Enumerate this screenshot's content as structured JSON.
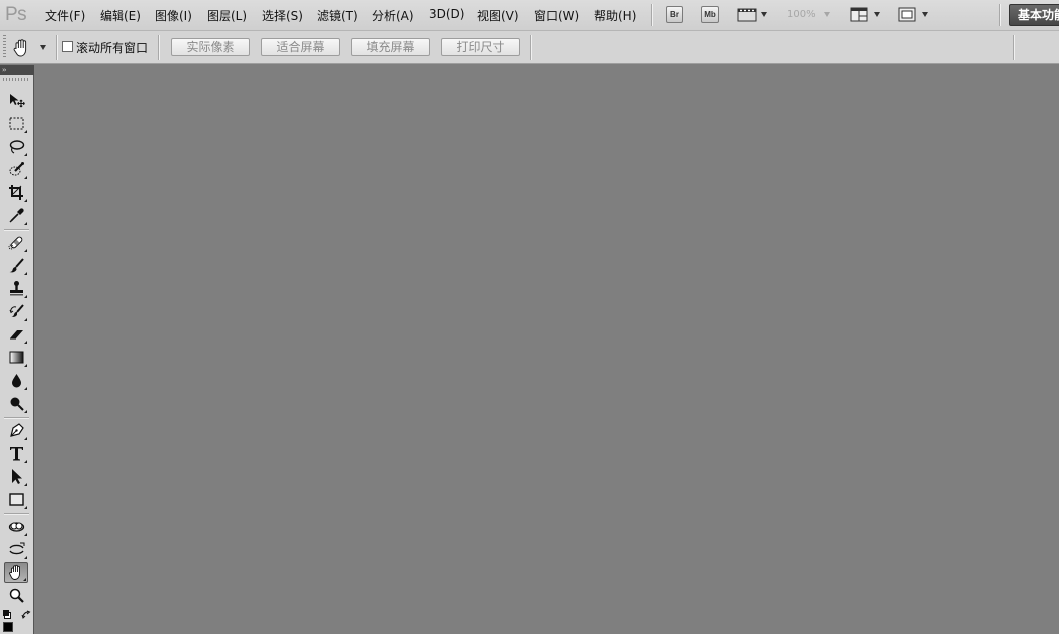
{
  "app": {
    "logo": "Ps"
  },
  "menu": [
    {
      "id": "file",
      "label": "文件(F)"
    },
    {
      "id": "edit",
      "label": "编辑(E)"
    },
    {
      "id": "image",
      "label": "图像(I)"
    },
    {
      "id": "layer",
      "label": "图层(L)"
    },
    {
      "id": "select",
      "label": "选择(S)"
    },
    {
      "id": "filter",
      "label": "滤镜(T)"
    },
    {
      "id": "analysis",
      "label": "分析(A)"
    },
    {
      "id": "3d",
      "label": "3D(D)"
    },
    {
      "id": "view",
      "label": "视图(V)"
    },
    {
      "id": "window",
      "label": "窗口(W)"
    },
    {
      "id": "help",
      "label": "帮助(H)"
    }
  ],
  "appbar": {
    "bridge_label": "Br",
    "mini_bridge_label": "Mb",
    "zoom": "100%",
    "workspace": "基本功能"
  },
  "options": {
    "scroll_all_windows": "滚动所有窗口",
    "scroll_all_checked": false,
    "buttons": [
      "实际像素",
      "适合屏幕",
      "填充屏幕",
      "打印尺寸"
    ]
  },
  "tools_panel": {
    "collapse_label": "››",
    "tools": [
      {
        "name": "move-tool",
        "icon": "move-icon"
      },
      {
        "name": "marquee-tool",
        "icon": "rect-marquee-icon"
      },
      {
        "name": "lasso-tool",
        "icon": "lasso-icon"
      },
      {
        "name": "quick-selection-tool",
        "icon": "quick-select-icon"
      },
      {
        "name": "crop-tool",
        "icon": "crop-icon"
      },
      {
        "name": "eyedropper-tool",
        "icon": "eyedropper-icon"
      },
      {
        "name": "spot-healing-tool",
        "icon": "bandage-icon"
      },
      {
        "name": "brush-tool",
        "icon": "brush-icon"
      },
      {
        "name": "clone-stamp-tool",
        "icon": "stamp-icon"
      },
      {
        "name": "history-brush-tool",
        "icon": "history-brush-icon"
      },
      {
        "name": "eraser-tool",
        "icon": "eraser-icon"
      },
      {
        "name": "gradient-tool",
        "icon": "gradient-icon"
      },
      {
        "name": "blur-tool",
        "icon": "drop-icon"
      },
      {
        "name": "dodge-tool",
        "icon": "dodge-icon"
      },
      {
        "name": "pen-tool",
        "icon": "pen-icon"
      },
      {
        "name": "type-tool",
        "icon": "type-icon"
      },
      {
        "name": "path-selection-tool",
        "icon": "arrow-icon"
      },
      {
        "name": "shape-tool",
        "icon": "rectangle-icon"
      },
      {
        "name": "3d-rotate-tool",
        "icon": "3d-rotate-icon"
      },
      {
        "name": "3d-orbit-tool",
        "icon": "3d-orbit-icon"
      },
      {
        "name": "hand-tool",
        "icon": "hand-icon",
        "active": true
      },
      {
        "name": "zoom-tool",
        "icon": "magnifier-icon"
      }
    ]
  },
  "colors": {
    "canvas_bg": "#7f7f7f",
    "panel_bg": "#d4d4d4",
    "menubar_bg": "#d8d8d8",
    "foreground": "#000000",
    "background": "#ffffff"
  }
}
